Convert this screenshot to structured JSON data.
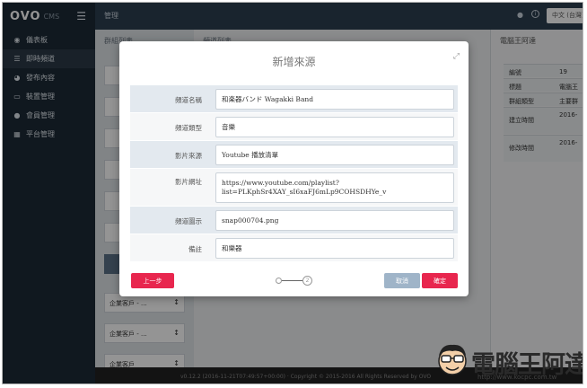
{
  "sidebar": {
    "logo": "OVO",
    "logo_sub": "CMS",
    "menu_icon": "hamburger-icon",
    "items": [
      {
        "label": "儀表板",
        "icon": "dashboard-icon"
      },
      {
        "label": "即時頻道",
        "icon": "list-icon"
      },
      {
        "label": "發布內容",
        "icon": "broadcast-icon"
      },
      {
        "label": "裝置管理",
        "icon": "monitor-icon"
      },
      {
        "label": "會員管理",
        "icon": "user-icon"
      },
      {
        "label": "平台管理",
        "icon": "grid-icon"
      }
    ]
  },
  "topbar": {
    "title": "管理",
    "language": "中文 (台灣)"
  },
  "columns": {
    "left_header": "群組列表",
    "mid_header": "頻道列表",
    "right_header": "電腦王阿達",
    "cards": [
      "企業客戶 - ...",
      "企業客戶 - ...",
      "企業客戶"
    ],
    "details": [
      {
        "label": "編號",
        "value": "19"
      },
      {
        "label": "標題",
        "value": "電腦王"
      },
      {
        "label": "群組類型",
        "value": "主要群"
      },
      {
        "label": "建立時間",
        "value": "2016-"
      },
      {
        "label": "修改時間",
        "value": "2016-"
      }
    ]
  },
  "footer": {
    "text": "v0.12.2 (2016-11-21T07:49:57+00:00) · Copyright © 2015-2016 All Rights Reserved by OVO"
  },
  "modal": {
    "title": "新增來源",
    "fields": [
      {
        "label": "頻道名稱",
        "value": "和楽器バンド Wagakki Band"
      },
      {
        "label": "頻道類型",
        "value": "音樂"
      },
      {
        "label": "影片來源",
        "value": "Youtube 播放清單"
      },
      {
        "label": "影片網址",
        "value_line1": "https://www.youtube.com/playlist?",
        "value_line2": "list=PLKphSr4XAY_sI6xaFJ6mLp9COHSDHYe_v"
      },
      {
        "label": "頻道圖示",
        "value": "snap000704.png"
      },
      {
        "label": "備註",
        "value": "和樂器"
      }
    ],
    "prev_label": "上一步",
    "step_number": "2",
    "cancel_label": "取消",
    "confirm_label": "確定"
  },
  "watermark": {
    "text": "電腦王阿達",
    "url": "http://www.kocpc.com.tw"
  },
  "colors": {
    "sidebar": "#1d2a36",
    "topbar": "#2c3e50",
    "accent_red": "#e8264e",
    "cancel": "#9fb4c8"
  }
}
